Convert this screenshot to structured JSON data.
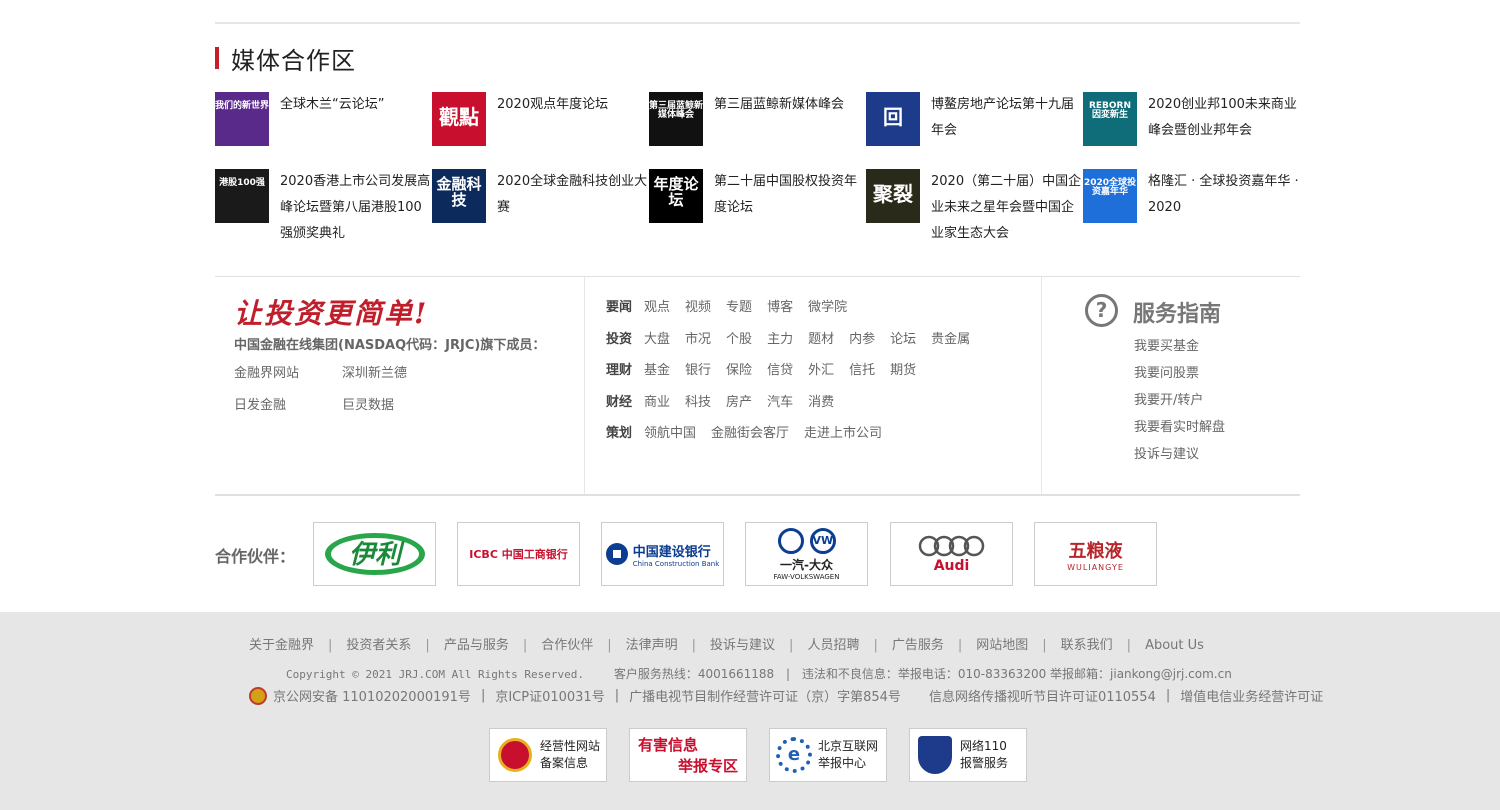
{
  "media_section": {
    "title": "媒体合作区",
    "items": [
      {
        "caption": "全球木兰“云论坛”",
        "thumb_text": "我们的新世界",
        "thumb_bg": "#5a2a8a"
      },
      {
        "caption": "2020观点年度论坛",
        "thumb_text": "觀點",
        "thumb_bg": "#c8102e"
      },
      {
        "caption": "第三届蓝鲸新媒体峰会",
        "thumb_text": "第三届蓝鲸新媒体峰会",
        "thumb_bg": "#111111"
      },
      {
        "caption": "博鳌房地产论坛第十九届年会",
        "thumb_text": "回",
        "thumb_bg": "#1e3a8a"
      },
      {
        "caption": "2020创业邦100未来商业峰会暨创业邦年会",
        "thumb_text": "REBORN 因変新生",
        "thumb_bg": "#0f6d7a"
      },
      {
        "caption": "2020香港上市公司发展高峰论坛暨第八届港股100强颁奖典礼",
        "thumb_text": "港股100强",
        "thumb_bg": "#1a1a1a"
      },
      {
        "caption": "2020全球金融科技创业大赛",
        "thumb_text": "金融科技",
        "thumb_bg": "#0d2a5c"
      },
      {
        "caption": "第二十届中国股权投资年度论坛",
        "thumb_text": "年度论坛",
        "thumb_bg": "#000000"
      },
      {
        "caption": "2020（第二十届）中国企业未来之星年会暨中国企业家生态大会",
        "thumb_text": "聚裂",
        "thumb_bg": "#2a2a1a"
      },
      {
        "caption": "格隆汇 · 全球投资嘉年华 · 2020",
        "thumb_text": "2020全球投资嘉年华",
        "thumb_bg": "#1e6fd9"
      }
    ]
  },
  "about": {
    "slogan": "让投资更简单!",
    "group_desc": "中国金融在线集团(NASDAQ代码：JRJC)旗下成员：",
    "members": [
      "金融界网站",
      "深圳新兰德",
      "日发金融",
      "巨灵数据"
    ]
  },
  "nav": {
    "rows": [
      {
        "cat": "要闻",
        "links": [
          "观点",
          "视频",
          "专题",
          "博客",
          "微学院"
        ]
      },
      {
        "cat": "投资",
        "links": [
          "大盘",
          "市况",
          "个股",
          "主力",
          "题材",
          "内参",
          "论坛",
          "贵金属"
        ]
      },
      {
        "cat": "理财",
        "links": [
          "基金",
          "银行",
          "保险",
          "信贷",
          "外汇",
          "信托",
          "期货"
        ]
      },
      {
        "cat": "财经",
        "links": [
          "商业",
          "科技",
          "房产",
          "汽车",
          "消费"
        ]
      },
      {
        "cat": "策划",
        "links": [
          "领航中国",
          "金融街会客厅",
          "走进上市公司"
        ]
      }
    ]
  },
  "service": {
    "icon": "?",
    "title": "服务指南",
    "links": [
      "我要买基金",
      "我要问股票",
      "我要开/转户",
      "我要看实时解盘",
      "投诉与建议"
    ]
  },
  "partners": {
    "label": "合作伙伴：",
    "items": [
      {
        "name": "伊利",
        "color": "#1a8a3a"
      },
      {
        "name": "ICBC 中国工商银行",
        "color": "#c8102e"
      },
      {
        "name": "中国建设银行",
        "sub": "China Construction Bank",
        "color": "#0b3d91"
      },
      {
        "name": "一汽-大众",
        "sub": "FAW-VOLKSWAGEN",
        "color": "#0b3d91"
      },
      {
        "name": "Audi",
        "color": "#c8102e"
      },
      {
        "name": "五粮液",
        "sub": "WULIANGYE",
        "color": "#b8262c"
      }
    ]
  },
  "footer": {
    "nav": [
      "关于金融界",
      "投资者关系",
      "产品与服务",
      "合作伙伴",
      "法律声明",
      "投诉与建议",
      "人员招聘",
      "广告服务",
      "网站地图",
      "联系我们",
      "About Us"
    ],
    "separator": "|",
    "copyright": "Copyright © 2021 JRJ.COM All Rights Reserved.",
    "hotline": "客户服务热线：4001661188",
    "report": "违法和不良信息：举报电话：010-83363200 举报邮箱：jiankong@jrj.com.cn",
    "license": [
      "京公网安备 11010202000191号",
      "京ICP证010031号",
      "广播电视节目制作经营许可证（京）字第854号",
      "信息网络传播视听节目许可证0110554",
      "增值电信业务经营许可证"
    ],
    "badges": [
      {
        "line1": "经营性网站",
        "line2": "备案信息",
        "color": "#c8102e"
      },
      {
        "line1": "有害信息",
        "line2": "举报专区",
        "color": "#c8102e"
      },
      {
        "line1": "北京互联网",
        "line2": "举报中心",
        "color": "#1e5fb8"
      },
      {
        "line1": "网络110",
        "line2": "报警服务",
        "color": "#1e3a8a"
      }
    ]
  }
}
